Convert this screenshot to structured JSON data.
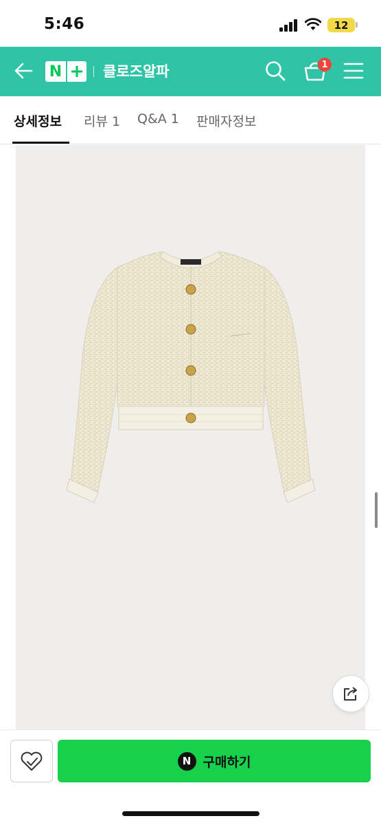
{
  "status_bar": {
    "time": "5:46",
    "battery": "12",
    "battery_color": "#f2d94a"
  },
  "header": {
    "logo_n": "N",
    "logo_plus": "+",
    "store_name": "클로즈알파",
    "cart_count": "1",
    "background_color": "#2ec4a5",
    "icons": [
      "back-arrow-icon",
      "search-icon",
      "cart-icon",
      "hamburger-menu-icon"
    ]
  },
  "tabs": [
    {
      "label": "상세정보",
      "active": true
    },
    {
      "label": "리뷰 1",
      "active": false
    },
    {
      "label": "Q&A 1",
      "active": false
    },
    {
      "label": "판매자정보",
      "active": false
    }
  ],
  "product": {
    "image_subject": "cream tweed cropped jacket with gold buttons",
    "share_icon": "share-icon"
  },
  "bottom_bar": {
    "wish_icon": "heart-check-icon",
    "buy_icon_text": "N",
    "buy_label": "구매하기",
    "buy_color": "#17d14d"
  }
}
